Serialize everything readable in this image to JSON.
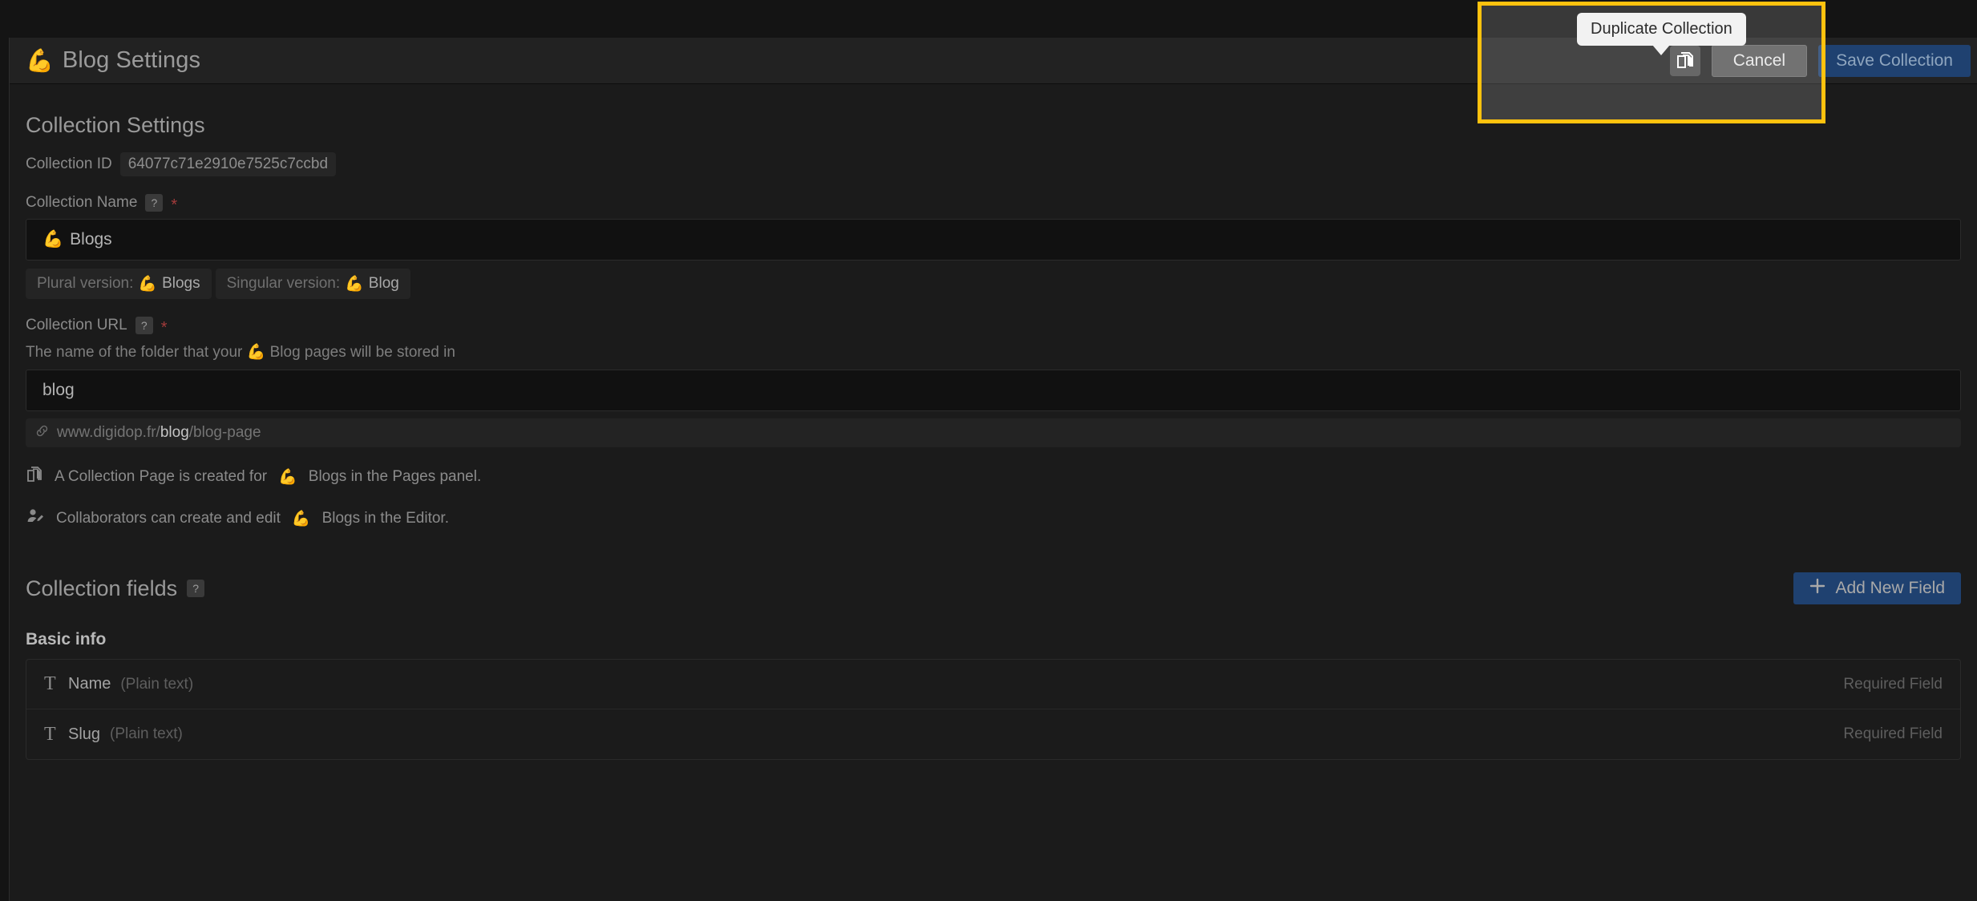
{
  "header": {
    "emoji": "💪",
    "title": "Blog Settings",
    "duplicate_icon": "duplicate-collection-icon",
    "cancel_label": "Cancel",
    "save_label": "Save Collection"
  },
  "tooltip": {
    "text": "Duplicate Collection"
  },
  "collection_settings": {
    "section_title": "Collection Settings",
    "collection_id_label": "Collection ID",
    "collection_id_value": "64077c71e2910e7525c7ccbd",
    "collection_name_label": "Collection Name",
    "help_badge": "?",
    "required_marker": "*",
    "collection_name_emoji": "💪",
    "collection_name_value": "Blogs",
    "plural_prefix": "Plural version:",
    "plural_emoji": "💪",
    "plural_value": "Blogs",
    "singular_prefix": "Singular version:",
    "singular_emoji": "💪",
    "singular_value": "Blog",
    "collection_url_label": "Collection URL",
    "url_helper_pre": "The name of the folder that your",
    "url_helper_emoji": "💪",
    "url_helper_post": "Blog pages will be stored in",
    "collection_url_value": "blog",
    "url_preview_icon": "link-icon",
    "url_preview_domain": "www.digidop.fr/",
    "url_preview_slug": "blog",
    "url_preview_tail": "/blog-page",
    "note_1_icon": "pages-copy-icon",
    "note_1_pre": "A Collection Page is created for",
    "note_1_emoji": "💪",
    "note_1_post": "Blogs in the Pages panel.",
    "note_2_icon": "user-edit-icon",
    "note_2_pre": "Collaborators can create and edit",
    "note_2_emoji": "💪",
    "note_2_post": "Blogs in the Editor."
  },
  "collection_fields": {
    "title": "Collection fields",
    "help_badge": "?",
    "add_button_label": "Add New Field",
    "add_button_icon": "plus-icon",
    "group_title": "Basic info",
    "rows": [
      {
        "icon": "text-type-icon",
        "icon_glyph": "T",
        "name": "Name",
        "type": "(Plain text)",
        "required": "Required Field"
      },
      {
        "icon": "text-type-icon",
        "icon_glyph": "T",
        "name": "Slug",
        "type": "(Plain text)",
        "required": "Required Field"
      }
    ]
  },
  "colors": {
    "accent_blue": "#1f4170",
    "highlight_yellow": "#ffc20e",
    "page_bg": "#1b1b1b",
    "header_bg": "#222222",
    "emoji_gold": "#d99c1c"
  }
}
